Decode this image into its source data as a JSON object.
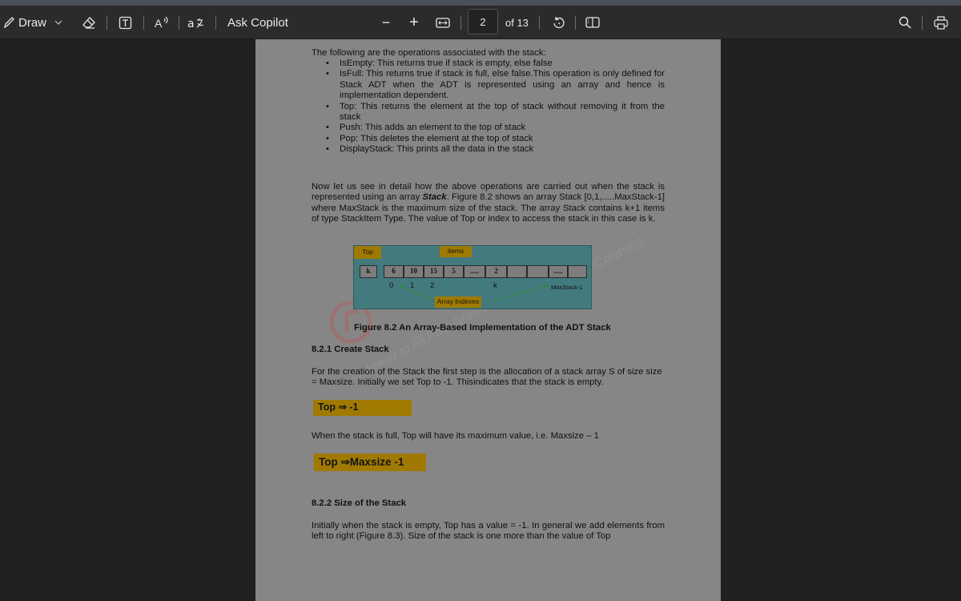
{
  "toolbar": {
    "draw_label": "Draw",
    "ask_copilot_label": "Ask Copilot",
    "page_number": "2",
    "page_total_label": "of 13",
    "zoom_out_symbol": "−",
    "zoom_in_symbol": "+"
  },
  "icons": [
    "draw-icon",
    "chevron-down-icon",
    "eraser-icon",
    "text-box-icon",
    "read-aloud-icon",
    "translate-icon",
    "fit-width-icon",
    "rotate-icon",
    "page-view-icon",
    "search-icon",
    "print-icon"
  ],
  "document": {
    "ops_intro": "The following are the operations associated with the stack:",
    "ops": [
      "IsEmpty: This returns true if stack is empty, else false",
      "IsFull: This returns true if stack is full, else false.This operation is only defined for Stack ADT when the ADT is represented using an array and hence is implementation dependent.",
      "Top: This returns the element at the top of stack without removing it from the stack",
      "Push: This adds an element to the top of stack",
      "Pop: This deletes the element at the top of stack",
      "DisplayStack: This prints all the data in the stack"
    ],
    "para1_a": "Now let us see in detail how the above operations are carried out when the stack is represented using an array ",
    "para1_em": "Stack",
    "para1_b": ". Figure 8.2 shows an array Stack [0,1,.....MaxStack-1] where MaxStack is the maximum size of the stack. The array Stack contains k+1 items of type StackItem Type. The value of Top or index to access the stack in this case is k.",
    "figure": {
      "top_label": "Top",
      "items_label": "items",
      "top_cell": "k",
      "cells": [
        "6",
        "10",
        "15",
        "5",
        ".....",
        "2",
        "",
        "",
        ".....",
        ""
      ],
      "index_0": "0",
      "index_1": "1",
      "index_2": "2",
      "index_k": "k",
      "index_max": "MaxStack-1",
      "array_indexes_label": "Array Indexes"
    },
    "figure_caption": "Figure 8.2 An Array-Based Implementation of the ADT Stack",
    "h_create": "8.2.1 Create Stack",
    "para_create": "For the creation of the Stack the first step is the allocation of a stack array S of size size = Maxsize. Initially we set Top to -1. Thisindicates that the stack is empty.",
    "box1": "Top ⇒ -1",
    "para_full": "When the stack is full, Top will have its maximum value, i.e. Maxsize – 1",
    "box2": "Top ⇒Maxsize -1",
    "h_size": "8.2.2 Size of the Stack",
    "para_size": "Initially when the stack is empty, Top has a value = -1. In general we add elements from left to right (Figure 8.3). Size of the stack is one more than the value of Top"
  },
  "watermark": {
    "courses": "Courses",
    "gate": "Gateway to All Post Gradu"
  },
  "colors": {
    "toolbar_bg": "#2b2b2b",
    "viewer_bg": "#202020",
    "page_bg": "#868686",
    "highlight": "#a07a00",
    "figure_bg": "#437a7e"
  }
}
